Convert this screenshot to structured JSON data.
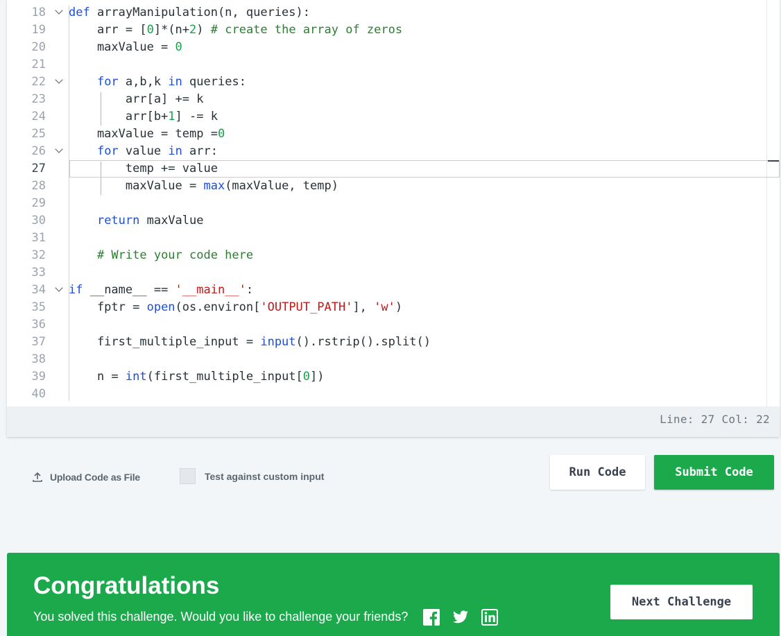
{
  "editor": {
    "lines": [
      {
        "n": "18",
        "fold": true,
        "active": false,
        "tokens": [
          {
            "t": "def",
            "c": "kw"
          },
          {
            "t": " arrayManipulation(n, queries):",
            "c": ""
          }
        ]
      },
      {
        "n": "19",
        "fold": false,
        "active": false,
        "tokens": [
          {
            "t": "    arr = [",
            "c": ""
          },
          {
            "t": "0",
            "c": "num"
          },
          {
            "t": "]*(n+",
            "c": ""
          },
          {
            "t": "2",
            "c": "num"
          },
          {
            "t": ") ",
            "c": ""
          },
          {
            "t": "# create the array of zeros",
            "c": "cm"
          }
        ]
      },
      {
        "n": "20",
        "fold": false,
        "active": false,
        "tokens": [
          {
            "t": "    maxValue = ",
            "c": ""
          },
          {
            "t": "0",
            "c": "num"
          }
        ]
      },
      {
        "n": "21",
        "fold": false,
        "active": false,
        "tokens": []
      },
      {
        "n": "22",
        "fold": true,
        "active": false,
        "tokens": [
          {
            "t": "    ",
            "c": ""
          },
          {
            "t": "for",
            "c": "kw"
          },
          {
            "t": " a,b,k ",
            "c": ""
          },
          {
            "t": "in",
            "c": "kw"
          },
          {
            "t": " queries:",
            "c": ""
          }
        ]
      },
      {
        "n": "23",
        "fold": false,
        "active": false,
        "tokens": [
          {
            "t": "        arr[a] += k",
            "c": ""
          }
        ]
      },
      {
        "n": "24",
        "fold": false,
        "active": false,
        "tokens": [
          {
            "t": "        arr[b+",
            "c": ""
          },
          {
            "t": "1",
            "c": "num"
          },
          {
            "t": "] -= k",
            "c": ""
          }
        ]
      },
      {
        "n": "25",
        "fold": false,
        "active": false,
        "tokens": [
          {
            "t": "    maxValue = temp =",
            "c": ""
          },
          {
            "t": "0",
            "c": "num"
          }
        ]
      },
      {
        "n": "26",
        "fold": true,
        "active": false,
        "tokens": [
          {
            "t": "    ",
            "c": ""
          },
          {
            "t": "for",
            "c": "kw"
          },
          {
            "t": " value ",
            "c": ""
          },
          {
            "t": "in",
            "c": "kw"
          },
          {
            "t": " arr:",
            "c": ""
          }
        ]
      },
      {
        "n": "27",
        "fold": false,
        "active": true,
        "tokens": [
          {
            "t": "        temp += value",
            "c": ""
          }
        ]
      },
      {
        "n": "28",
        "fold": false,
        "active": false,
        "tokens": [
          {
            "t": "        maxValue = ",
            "c": ""
          },
          {
            "t": "max",
            "c": "bi"
          },
          {
            "t": "(maxValue, temp)",
            "c": ""
          }
        ]
      },
      {
        "n": "29",
        "fold": false,
        "active": false,
        "tokens": []
      },
      {
        "n": "30",
        "fold": false,
        "active": false,
        "tokens": [
          {
            "t": "    ",
            "c": ""
          },
          {
            "t": "return",
            "c": "kw"
          },
          {
            "t": " maxValue",
            "c": ""
          }
        ]
      },
      {
        "n": "31",
        "fold": false,
        "active": false,
        "tokens": []
      },
      {
        "n": "32",
        "fold": false,
        "active": false,
        "tokens": [
          {
            "t": "    ",
            "c": ""
          },
          {
            "t": "# Write your code here",
            "c": "cm"
          }
        ]
      },
      {
        "n": "33",
        "fold": false,
        "active": false,
        "tokens": []
      },
      {
        "n": "34",
        "fold": true,
        "active": false,
        "tokens": [
          {
            "t": "if",
            "c": "kw"
          },
          {
            "t": " __name__ == ",
            "c": ""
          },
          {
            "t": "'__main__'",
            "c": "str"
          },
          {
            "t": ":",
            "c": ""
          }
        ]
      },
      {
        "n": "35",
        "fold": false,
        "active": false,
        "tokens": [
          {
            "t": "    fptr = ",
            "c": ""
          },
          {
            "t": "open",
            "c": "bi"
          },
          {
            "t": "(os.environ[",
            "c": ""
          },
          {
            "t": "'OUTPUT_PATH'",
            "c": "str"
          },
          {
            "t": "], ",
            "c": ""
          },
          {
            "t": "'w'",
            "c": "str"
          },
          {
            "t": ")",
            "c": ""
          }
        ]
      },
      {
        "n": "36",
        "fold": false,
        "active": false,
        "tokens": []
      },
      {
        "n": "37",
        "fold": false,
        "active": false,
        "tokens": [
          {
            "t": "    first_multiple_input = ",
            "c": ""
          },
          {
            "t": "input",
            "c": "bi"
          },
          {
            "t": "().rstrip().split()",
            "c": ""
          }
        ]
      },
      {
        "n": "38",
        "fold": false,
        "active": false,
        "tokens": []
      },
      {
        "n": "39",
        "fold": false,
        "active": false,
        "tokens": [
          {
            "t": "    n = ",
            "c": ""
          },
          {
            "t": "int",
            "c": "bi"
          },
          {
            "t": "(first_multiple_input[",
            "c": ""
          },
          {
            "t": "0",
            "c": "num"
          },
          {
            "t": "])",
            "c": ""
          }
        ]
      },
      {
        "n": "40",
        "fold": false,
        "active": false,
        "tokens": []
      }
    ],
    "status": "Line: 27 Col: 22"
  },
  "actions": {
    "upload_label": "Upload Code as File",
    "custom_input_label": "Test against custom input",
    "run_label": "Run Code",
    "submit_label": "Submit Code"
  },
  "congrats": {
    "title": "Congratulations",
    "subtitle": "You solved this challenge. Would you like to challenge your friends?",
    "next_label": "Next Challenge",
    "social_icons": [
      "facebook-icon",
      "twitter-icon",
      "linkedin-icon"
    ]
  },
  "colors": {
    "accent_green": "#1ba94c",
    "keyword_blue": "#1d4ed8",
    "number_green": "#16a34a",
    "string_red": "#c21818",
    "comment_green": "#2e7d32"
  }
}
